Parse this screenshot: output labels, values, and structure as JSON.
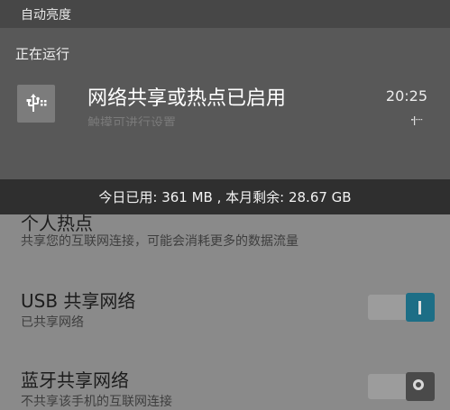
{
  "shade": {
    "brightness_label": "自动亮度",
    "running_label": "正在运行",
    "notification": {
      "title": "网络共享或热点已启用",
      "subtitle": "触摸可进行设置",
      "time": "20:25",
      "icon": "usb-icon"
    }
  },
  "usage_bar": {
    "text": "今日已用: 361 MB , 本月剩余: 28.67 GB"
  },
  "settings": {
    "hotspot": {
      "title": "个人热点",
      "desc": "共享您的互联网连接，可能会消耗更多的数据流量"
    },
    "usb": {
      "title": "USB 共享网络",
      "desc": "已共享网络",
      "state": "on"
    },
    "bluetooth": {
      "title": "蓝牙共享网络",
      "desc": "不共享该手机的互联网连接",
      "state": "off"
    }
  },
  "colors": {
    "toggle_on": "#1d6e86",
    "toggle_off": "#4a4a4a"
  }
}
